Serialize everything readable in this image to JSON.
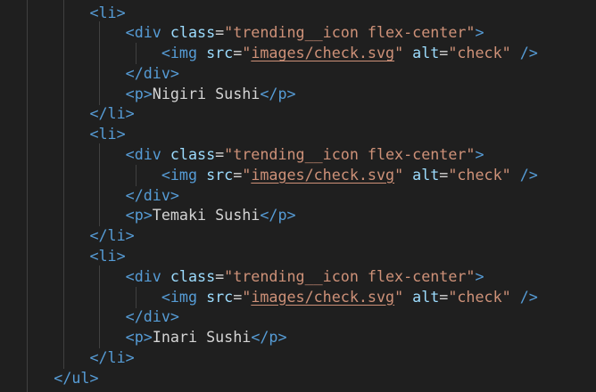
{
  "theme": {
    "background": "#1f1f1f",
    "tag_color": "#569cd6",
    "attr_color": "#9cdcfe",
    "string_color": "#ce9178",
    "text_color": "#d4d4d4",
    "indent_guide_color": "#404040"
  },
  "code": {
    "lines": [
      {
        "indent": "          ",
        "tokens": [
          {
            "t": "tag",
            "v": "<li>"
          }
        ]
      },
      {
        "indent": "              ",
        "tokens": [
          {
            "t": "tag",
            "v": "<div"
          },
          {
            "t": "text",
            "v": " "
          },
          {
            "t": "attr",
            "v": "class"
          },
          {
            "t": "text",
            "v": "="
          },
          {
            "t": "str",
            "v": "\"trending__icon flex-center\""
          },
          {
            "t": "tag",
            "v": ">"
          }
        ]
      },
      {
        "indent": "                  ",
        "tokens": [
          {
            "t": "tag",
            "v": "<img"
          },
          {
            "t": "text",
            "v": " "
          },
          {
            "t": "attr",
            "v": "src"
          },
          {
            "t": "text",
            "v": "="
          },
          {
            "t": "str",
            "v": "\""
          },
          {
            "t": "link",
            "v": "images/check.svg"
          },
          {
            "t": "str",
            "v": "\""
          },
          {
            "t": "text",
            "v": " "
          },
          {
            "t": "attr",
            "v": "alt"
          },
          {
            "t": "text",
            "v": "="
          },
          {
            "t": "str",
            "v": "\"check\""
          },
          {
            "t": "text",
            "v": " "
          },
          {
            "t": "tag",
            "v": "/>"
          }
        ]
      },
      {
        "indent": "              ",
        "tokens": [
          {
            "t": "tag",
            "v": "</div>"
          }
        ]
      },
      {
        "indent": "              ",
        "tokens": [
          {
            "t": "tag",
            "v": "<p>"
          },
          {
            "t": "text",
            "v": "Nigiri Sushi"
          },
          {
            "t": "tag",
            "v": "</p>"
          }
        ]
      },
      {
        "indent": "          ",
        "tokens": [
          {
            "t": "tag",
            "v": "</li>"
          }
        ]
      },
      {
        "indent": "          ",
        "tokens": [
          {
            "t": "tag",
            "v": "<li>"
          }
        ]
      },
      {
        "indent": "              ",
        "tokens": [
          {
            "t": "tag",
            "v": "<div"
          },
          {
            "t": "text",
            "v": " "
          },
          {
            "t": "attr",
            "v": "class"
          },
          {
            "t": "text",
            "v": "="
          },
          {
            "t": "str",
            "v": "\"trending__icon flex-center\""
          },
          {
            "t": "tag",
            "v": ">"
          }
        ]
      },
      {
        "indent": "                  ",
        "tokens": [
          {
            "t": "tag",
            "v": "<img"
          },
          {
            "t": "text",
            "v": " "
          },
          {
            "t": "attr",
            "v": "src"
          },
          {
            "t": "text",
            "v": "="
          },
          {
            "t": "str",
            "v": "\""
          },
          {
            "t": "link",
            "v": "images/check.svg"
          },
          {
            "t": "str",
            "v": "\""
          },
          {
            "t": "text",
            "v": " "
          },
          {
            "t": "attr",
            "v": "alt"
          },
          {
            "t": "text",
            "v": "="
          },
          {
            "t": "str",
            "v": "\"check\""
          },
          {
            "t": "text",
            "v": " "
          },
          {
            "t": "tag",
            "v": "/>"
          }
        ]
      },
      {
        "indent": "              ",
        "tokens": [
          {
            "t": "tag",
            "v": "</div>"
          }
        ]
      },
      {
        "indent": "              ",
        "tokens": [
          {
            "t": "tag",
            "v": "<p>"
          },
          {
            "t": "text",
            "v": "Temaki Sushi"
          },
          {
            "t": "tag",
            "v": "</p>"
          }
        ]
      },
      {
        "indent": "          ",
        "tokens": [
          {
            "t": "tag",
            "v": "</li>"
          }
        ]
      },
      {
        "indent": "          ",
        "tokens": [
          {
            "t": "tag",
            "v": "<li>"
          }
        ]
      },
      {
        "indent": "              ",
        "tokens": [
          {
            "t": "tag",
            "v": "<div"
          },
          {
            "t": "text",
            "v": " "
          },
          {
            "t": "attr",
            "v": "class"
          },
          {
            "t": "text",
            "v": "="
          },
          {
            "t": "str",
            "v": "\"trending__icon flex-center\""
          },
          {
            "t": "tag",
            "v": ">"
          }
        ]
      },
      {
        "indent": "                  ",
        "tokens": [
          {
            "t": "tag",
            "v": "<img"
          },
          {
            "t": "text",
            "v": " "
          },
          {
            "t": "attr",
            "v": "src"
          },
          {
            "t": "text",
            "v": "="
          },
          {
            "t": "str",
            "v": "\""
          },
          {
            "t": "link",
            "v": "images/check.svg"
          },
          {
            "t": "str",
            "v": "\""
          },
          {
            "t": "text",
            "v": " "
          },
          {
            "t": "attr",
            "v": "alt"
          },
          {
            "t": "text",
            "v": "="
          },
          {
            "t": "str",
            "v": "\"check\""
          },
          {
            "t": "text",
            "v": " "
          },
          {
            "t": "tag",
            "v": "/>"
          }
        ]
      },
      {
        "indent": "              ",
        "tokens": [
          {
            "t": "tag",
            "v": "</div>"
          }
        ]
      },
      {
        "indent": "              ",
        "tokens": [
          {
            "t": "tag",
            "v": "<p>"
          },
          {
            "t": "text",
            "v": "Inari Sushi"
          },
          {
            "t": "tag",
            "v": "</p>"
          }
        ]
      },
      {
        "indent": "          ",
        "tokens": [
          {
            "t": "tag",
            "v": "</li>"
          }
        ]
      },
      {
        "indent": "      ",
        "tokens": [
          {
            "t": "tag",
            "v": "</ul>"
          }
        ]
      }
    ]
  }
}
